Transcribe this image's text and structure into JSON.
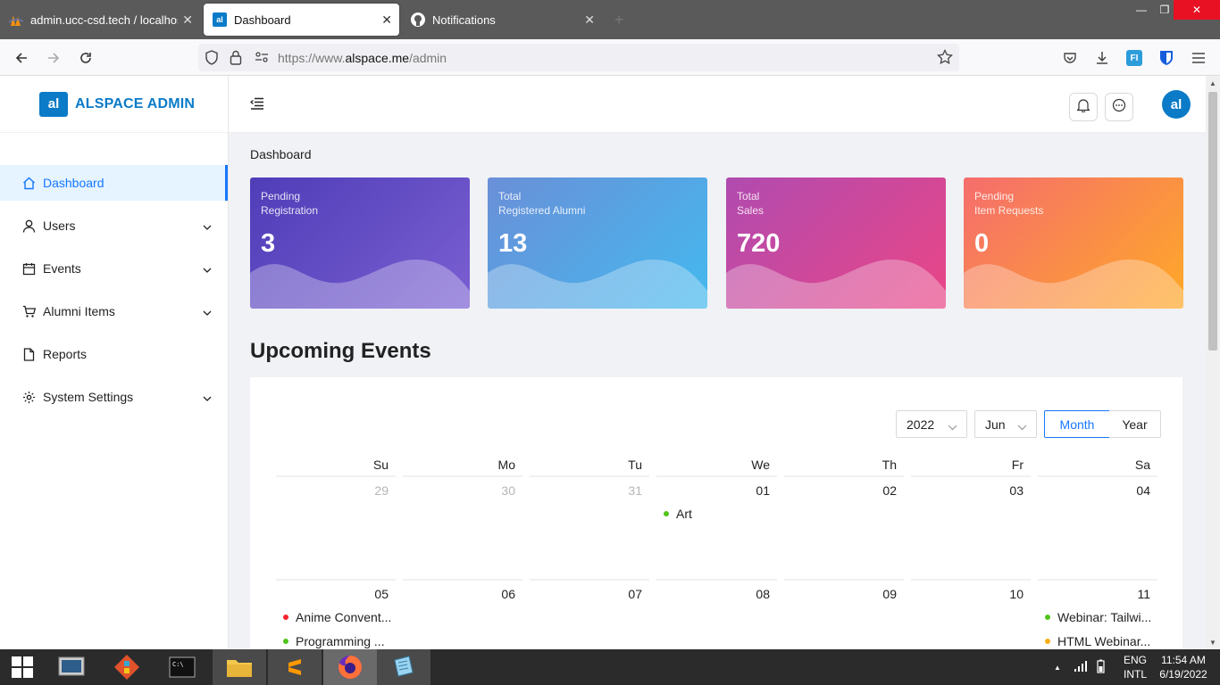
{
  "browser": {
    "tabs": [
      {
        "title": "admin.ucc-csd.tech / localhost"
      },
      {
        "title": "Dashboard"
      },
      {
        "title": "Notifications"
      }
    ],
    "url_prefix": "https://www.",
    "url_domain": "alspace.me",
    "url_path": "/admin"
  },
  "sidebar": {
    "logo_text": "al",
    "brand": "ALSPACE ADMIN",
    "items": [
      {
        "label": "Dashboard"
      },
      {
        "label": "Users"
      },
      {
        "label": "Events"
      },
      {
        "label": "Alumni Items"
      },
      {
        "label": "Reports"
      },
      {
        "label": "System Settings"
      }
    ]
  },
  "header": {
    "avatar_text": "al"
  },
  "breadcrumb": "Dashboard",
  "stats": [
    {
      "line1": "Pending",
      "line2": "Registration",
      "value": "3"
    },
    {
      "line1": "Total",
      "line2": "Registered Alumni",
      "value": "13"
    },
    {
      "line1": "Total",
      "line2": "Sales",
      "value": "720"
    },
    {
      "line1": "Pending",
      "line2": "Item Requests",
      "value": "0"
    }
  ],
  "events": {
    "title": "Upcoming Events",
    "year": "2022",
    "month": "Jun",
    "mode_month": "Month",
    "mode_year": "Year",
    "weekdays": [
      "Su",
      "Mo",
      "Tu",
      "We",
      "Th",
      "Fr",
      "Sa"
    ],
    "week1": [
      "29",
      "30",
      "31",
      "01",
      "02",
      "03",
      "04"
    ],
    "week2": [
      "05",
      "06",
      "07",
      "08",
      "09",
      "10",
      "11"
    ],
    "items": {
      "art": "Art",
      "anime": "Anime Convent...",
      "programming": "Programming ...",
      "tailwind": "Webinar: Tailwi...",
      "html": "HTML Webinar..."
    },
    "colors": {
      "green": "#52c41a",
      "red": "#f5222d",
      "orange": "#faad14"
    }
  },
  "taskbar": {
    "lang1": "ENG",
    "lang2": "INTL",
    "time": "11:54 AM",
    "date": "6/19/2022"
  }
}
